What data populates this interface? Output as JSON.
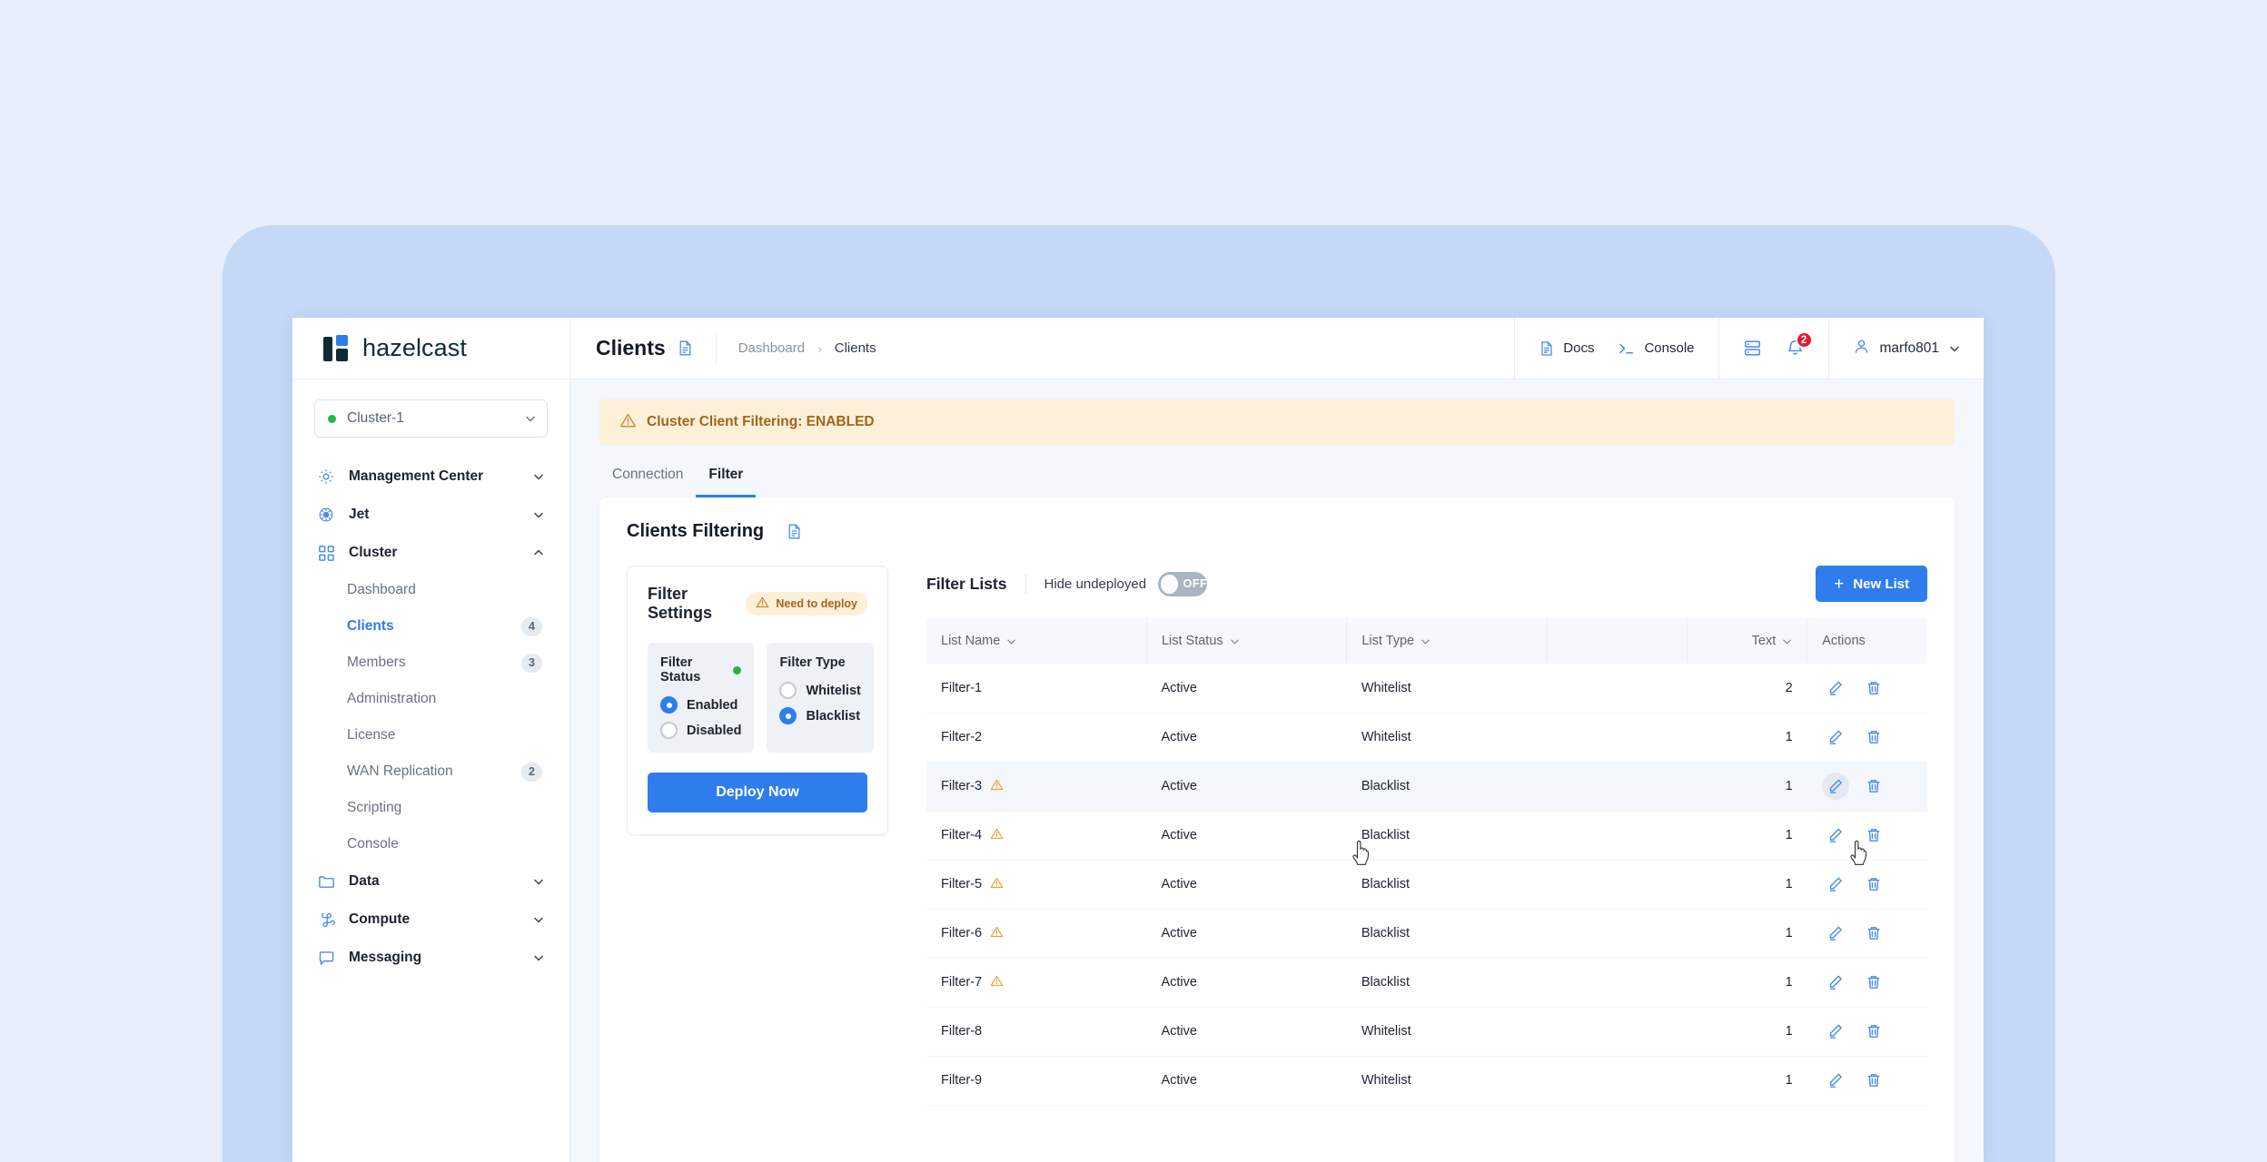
{
  "brand": {
    "name": "hazelcast"
  },
  "sidebar": {
    "cluster": {
      "name": "Cluster-1",
      "status_color": "#28b446"
    },
    "groups": [
      {
        "label": "Management Center",
        "icon": "gear-icon",
        "expanded": false
      },
      {
        "label": "Jet",
        "icon": "jet-icon",
        "expanded": false
      },
      {
        "label": "Cluster",
        "icon": "grid-icon",
        "expanded": true
      }
    ],
    "cluster_items": [
      {
        "label": "Dashboard",
        "badge": "",
        "active": false
      },
      {
        "label": "Clients",
        "badge": "4",
        "active": true
      },
      {
        "label": "Members",
        "badge": "3",
        "active": false
      },
      {
        "label": "Administration",
        "badge": "",
        "active": false
      },
      {
        "label": "License",
        "badge": "",
        "active": false
      },
      {
        "label": "WAN Replication",
        "badge": "2",
        "active": false
      },
      {
        "label": "Scripting",
        "badge": "",
        "active": false
      },
      {
        "label": "Console",
        "badge": "",
        "active": false
      }
    ],
    "groups_bottom": [
      {
        "label": "Data",
        "icon": "folder-icon"
      },
      {
        "label": "Compute",
        "icon": "command-icon"
      },
      {
        "label": "Messaging",
        "icon": "chat-icon"
      }
    ]
  },
  "topbar": {
    "page_title": "Clients",
    "breadcrumb": {
      "parent": "Dashboard",
      "separator": "›",
      "current": "Clients"
    },
    "docs_label": "Docs",
    "console_label": "Console",
    "notification_count": "2",
    "user_name": "marfo801"
  },
  "alert": {
    "text": "Cluster Client Filtering: ENABLED",
    "bg": "#fdf0d8",
    "fg": "#a3651a"
  },
  "tabs": [
    {
      "label": "Connection",
      "active": false
    },
    {
      "label": "Filter",
      "active": true
    }
  ],
  "panel": {
    "title": "Clients Filtering"
  },
  "filter_settings": {
    "title": "Filter Settings",
    "deploy_badge": "Need to deploy",
    "status": {
      "title": "Filter Status",
      "indicator_color": "#28b446",
      "options": [
        {
          "label": "Enabled",
          "selected": true
        },
        {
          "label": "Disabled",
          "selected": false
        }
      ]
    },
    "type": {
      "title": "Filter Type",
      "options": [
        {
          "label": "Whitelist",
          "selected": false
        },
        {
          "label": "Blacklist",
          "selected": true
        }
      ]
    },
    "deploy_button": "Deploy Now"
  },
  "filter_lists": {
    "title": "Filter Lists",
    "hide_undeployed_label": "Hide undeployed",
    "toggle_state": "OFF",
    "new_list_button": "New List",
    "columns": [
      "List Name",
      "List Status",
      "List Type",
      "",
      "Text",
      "Actions"
    ],
    "rows": [
      {
        "name": "Filter-1",
        "warn": false,
        "status": "Active",
        "type": "Whitelist",
        "text": "2",
        "dim": true,
        "highlight": false
      },
      {
        "name": "Filter-2",
        "warn": false,
        "status": "Active",
        "type": "Whitelist",
        "text": "1",
        "dim": true,
        "highlight": false
      },
      {
        "name": "Filter-3",
        "warn": true,
        "status": "Active",
        "type": "Blacklist",
        "text": "1",
        "dim": false,
        "highlight": true
      },
      {
        "name": "Filter-4",
        "warn": true,
        "status": "Active",
        "type": "Blacklist",
        "text": "1",
        "dim": false,
        "highlight": false
      },
      {
        "name": "Filter-5",
        "warn": true,
        "status": "Active",
        "type": "Blacklist",
        "text": "1",
        "dim": false,
        "highlight": false
      },
      {
        "name": "Filter-6",
        "warn": true,
        "status": "Active",
        "type": "Blacklist",
        "text": "1",
        "dim": false,
        "highlight": false
      },
      {
        "name": "Filter-7",
        "warn": true,
        "status": "Active",
        "type": "Blacklist",
        "text": "1",
        "dim": false,
        "highlight": false
      },
      {
        "name": "Filter-8",
        "warn": false,
        "status": "Active",
        "type": "Whitelist",
        "text": "1",
        "dim": true,
        "highlight": false
      },
      {
        "name": "Filter-9",
        "warn": false,
        "status": "Active",
        "type": "Whitelist",
        "text": "1",
        "dim": true,
        "highlight": false
      }
    ]
  },
  "theme": {
    "accent": "#2f7ded",
    "warn": "#e8a33d",
    "danger": "#e8192c",
    "backdrop": "#c3d9f7",
    "page_bg": "#e8eefb"
  }
}
